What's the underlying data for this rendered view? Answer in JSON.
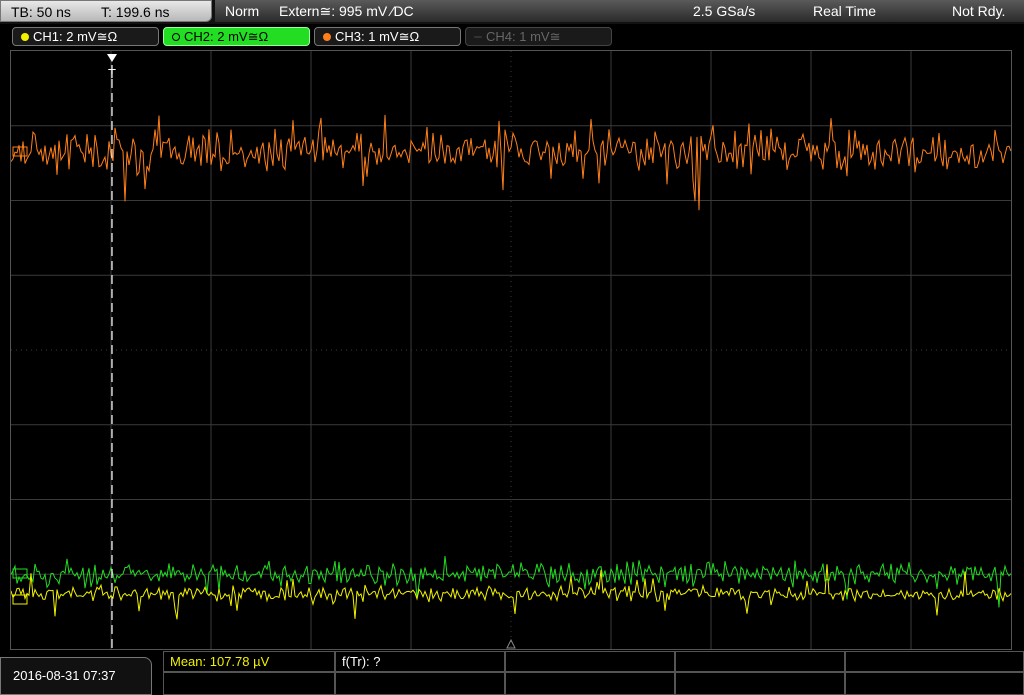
{
  "timebase": {
    "tb": "TB: 50 ns",
    "trigger_time": "T: 199.6 ns"
  },
  "status": {
    "mode": "Norm",
    "trigger": "Extern≅: 995 mV ⁄DC",
    "sample_rate": "2.5 GSa/s",
    "acq": "Real Time",
    "state": "Not Rdy."
  },
  "channels": [
    {
      "label": "CH1: 2 mV≅Ω",
      "color": "#f2f200"
    },
    {
      "label": "CH2: 2 mV≅Ω",
      "color": "#22dd22"
    },
    {
      "label": "CH3: 1 mV≅Ω",
      "color": "#ff7f1a"
    },
    {
      "label": "CH4: 1 mV≅",
      "color": "#666666"
    }
  ],
  "trigger_marker": "T",
  "datetime": "2016-08-31 07:37",
  "measurements": {
    "mean": "Mean: 107.78 µV",
    "ftr": "f(Tr): ?"
  },
  "colors": {
    "ch1": "#f2f200",
    "ch2": "#22dd22",
    "ch3": "#ff7f1a",
    "grid": "#3a3a3a"
  }
}
